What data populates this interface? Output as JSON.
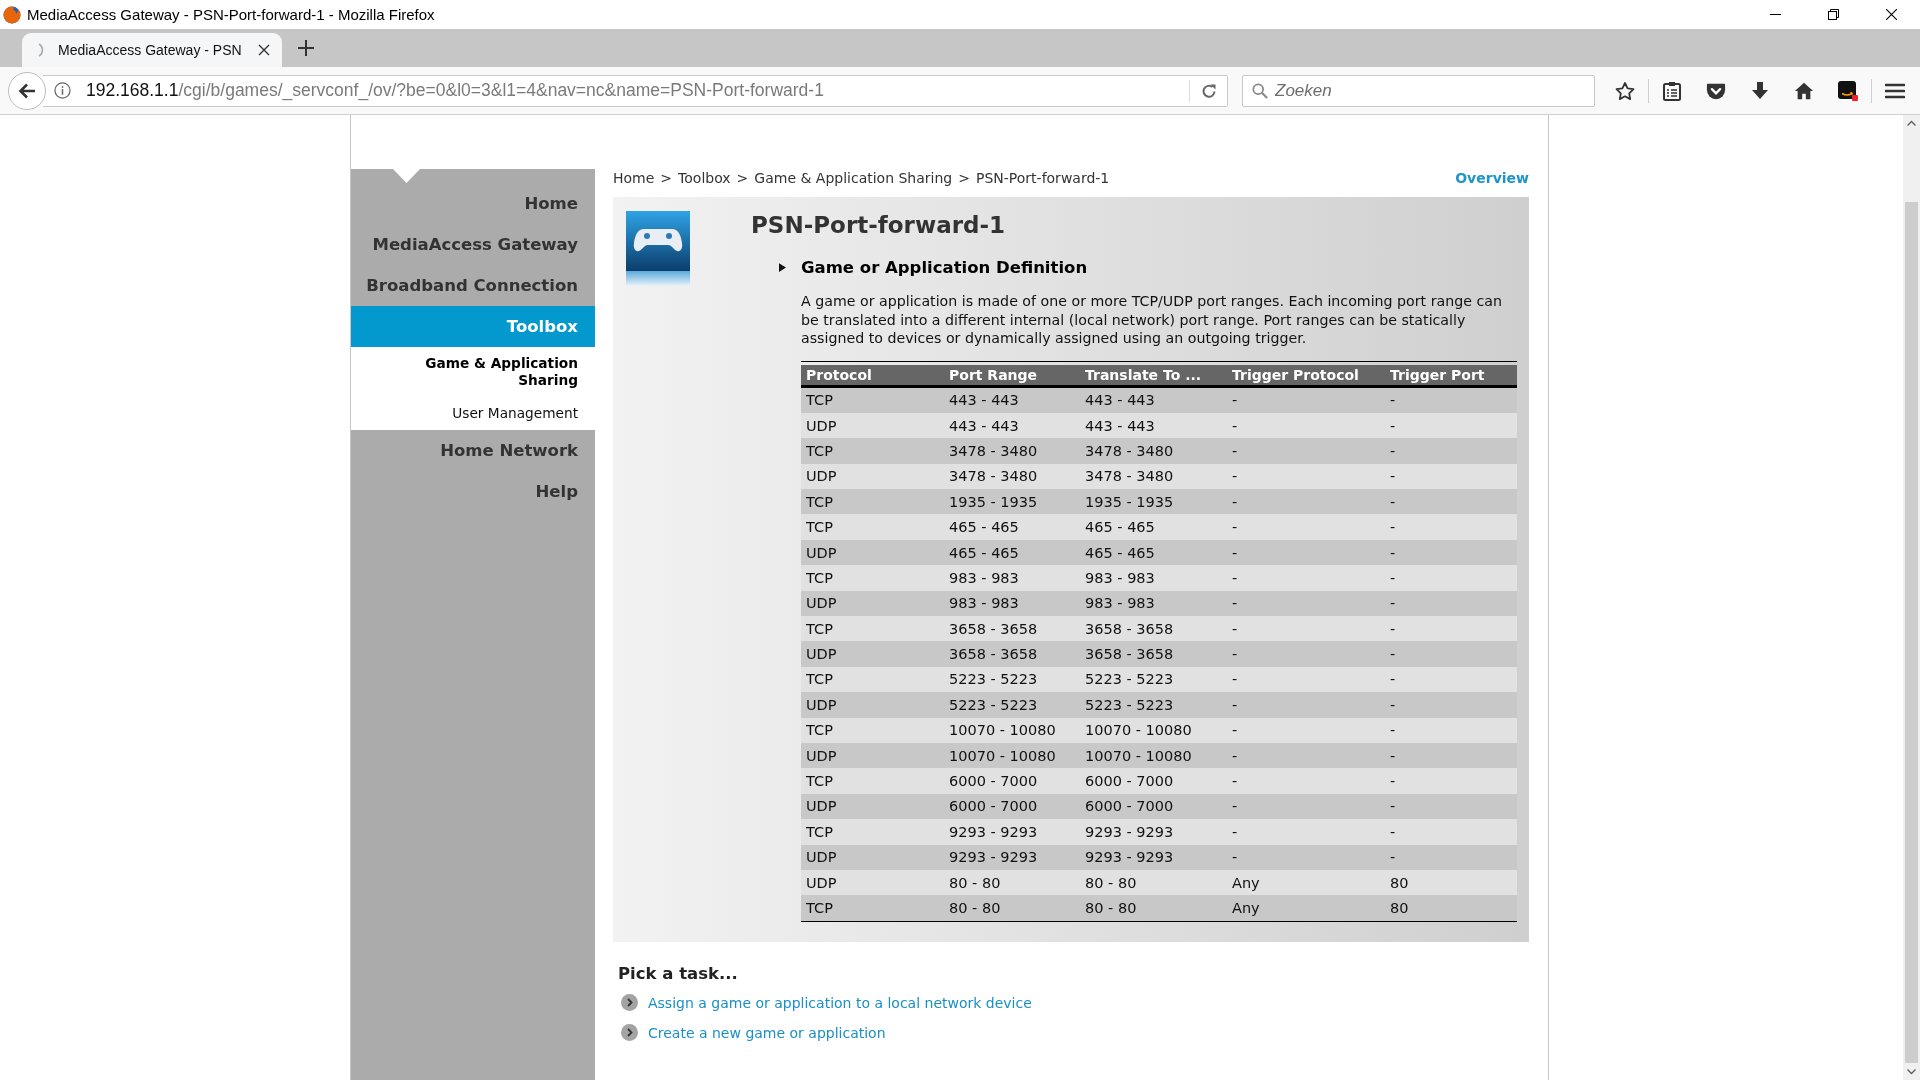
{
  "window": {
    "title": "MediaAccess Gateway - PSN-Port-forward-1 - Mozilla Firefox"
  },
  "tabs": [
    {
      "label": "MediaAccess Gateway - PSN",
      "selected": true
    }
  ],
  "address_bar": {
    "host": "192.168.1.1",
    "path": "/cgi/b/games/_servconf_/ov/?be=0&l0=3&l1=4&nav=nc&name=PSN-Port-forward-1"
  },
  "search": {
    "placeholder": "Zoeken"
  },
  "sidebar": {
    "items": [
      {
        "label": "Home",
        "selected": false
      },
      {
        "label": "MediaAccess Gateway",
        "selected": false
      },
      {
        "label": "Broadband Connection",
        "selected": false
      },
      {
        "label": "Toolbox",
        "selected": true,
        "children": [
          {
            "label": "Game & Application Sharing",
            "selected": true
          },
          {
            "label": "User Management",
            "selected": false
          }
        ]
      },
      {
        "label": "Home Network",
        "selected": false
      },
      {
        "label": "Help",
        "selected": false
      }
    ]
  },
  "breadcrumb": {
    "items": [
      "Home",
      "Toolbox",
      "Game & Application Sharing",
      "PSN-Port-forward-1"
    ],
    "separator": ">"
  },
  "overview_link": "Overview",
  "panel": {
    "title": "PSN-Port-forward-1",
    "section_heading": "Game or Application Definition",
    "description": "A game or application is made of one or more TCP/UDP port ranges. Each incoming port range can be translated into a different internal (local network) port range. Port ranges can be statically assigned to devices or dynamically assigned using an outgoing trigger.",
    "table": {
      "columns": [
        "Protocol",
        "Port Range",
        "Translate To ...",
        "Trigger Protocol",
        "Trigger Port"
      ],
      "rows": [
        [
          "TCP",
          "443 - 443",
          "443 - 443",
          "-",
          "-"
        ],
        [
          "UDP",
          "443 - 443",
          "443 - 443",
          "-",
          "-"
        ],
        [
          "TCP",
          "3478 - 3480",
          "3478 - 3480",
          "-",
          "-"
        ],
        [
          "UDP",
          "3478 - 3480",
          "3478 - 3480",
          "-",
          "-"
        ],
        [
          "TCP",
          "1935 - 1935",
          "1935 - 1935",
          "-",
          "-"
        ],
        [
          "TCP",
          "465 - 465",
          "465 - 465",
          "-",
          "-"
        ],
        [
          "UDP",
          "465 - 465",
          "465 - 465",
          "-",
          "-"
        ],
        [
          "TCP",
          "983 - 983",
          "983 - 983",
          "-",
          "-"
        ],
        [
          "UDP",
          "983 - 983",
          "983 - 983",
          "-",
          "-"
        ],
        [
          "TCP",
          "3658 - 3658",
          "3658 - 3658",
          "-",
          "-"
        ],
        [
          "UDP",
          "3658 - 3658",
          "3658 - 3658",
          "-",
          "-"
        ],
        [
          "TCP",
          "5223 - 5223",
          "5223 - 5223",
          "-",
          "-"
        ],
        [
          "UDP",
          "5223 - 5223",
          "5223 - 5223",
          "-",
          "-"
        ],
        [
          "TCP",
          "10070 - 10080",
          "10070 - 10080",
          "-",
          "-"
        ],
        [
          "UDP",
          "10070 - 10080",
          "10070 - 10080",
          "-",
          "-"
        ],
        [
          "TCP",
          "6000 - 7000",
          "6000 - 7000",
          "-",
          "-"
        ],
        [
          "UDP",
          "6000 - 7000",
          "6000 - 7000",
          "-",
          "-"
        ],
        [
          "TCP",
          "9293 - 9293",
          "9293 - 9293",
          "-",
          "-"
        ],
        [
          "UDP",
          "9293 - 9293",
          "9293 - 9293",
          "-",
          "-"
        ],
        [
          "UDP",
          "80 - 80",
          "80 - 80",
          "Any",
          "80"
        ],
        [
          "TCP",
          "80 - 80",
          "80 - 80",
          "Any",
          "80"
        ]
      ]
    }
  },
  "tasks": {
    "heading": "Pick a task...",
    "links": [
      "Assign a game or application to a local network device",
      "Create a new game or application"
    ]
  }
}
